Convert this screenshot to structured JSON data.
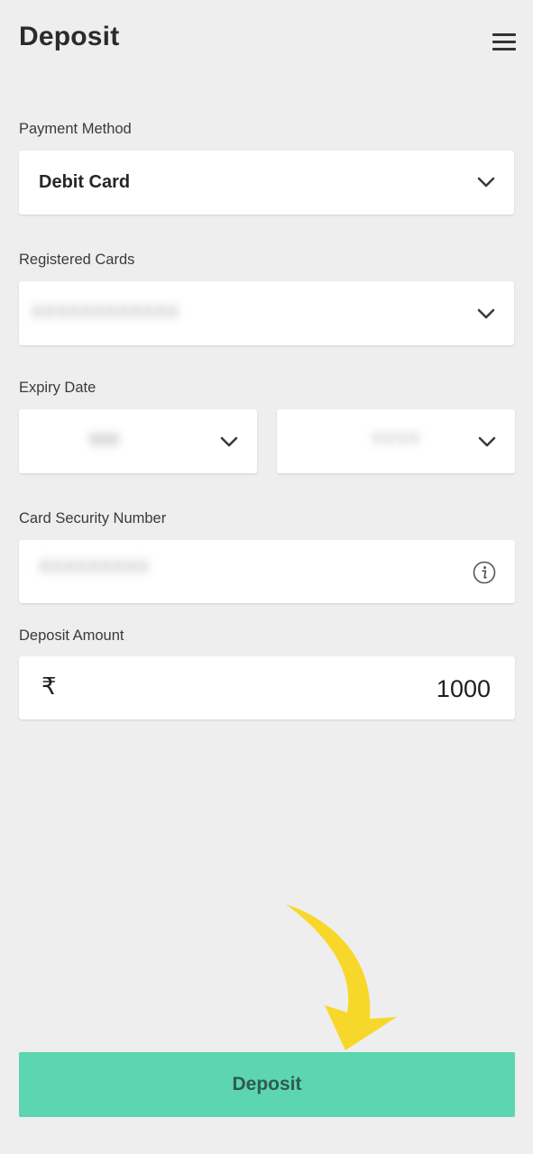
{
  "header": {
    "title": "Deposit",
    "menu_icon": "hamburger-menu-icon"
  },
  "form": {
    "payment_method": {
      "label": "Payment Method",
      "value": "Debit Card"
    },
    "registered_cards": {
      "label": "Registered Cards",
      "value": "XXXXXXXXXXXX"
    },
    "expiry_date": {
      "label": "Expiry Date",
      "month_value": "MM",
      "year_value": "YYYY"
    },
    "card_security_number": {
      "label": "Card Security Number",
      "value": "XXXXXXXXX",
      "info_icon": "info-icon"
    },
    "deposit_amount": {
      "label": "Deposit Amount",
      "currency_symbol": "₹",
      "value": "1000"
    }
  },
  "actions": {
    "deposit_label": "Deposit"
  },
  "colors": {
    "background": "#eeeeee",
    "button": "#5dd5b0",
    "button_text": "#2f5b4d",
    "arrow": "#f7d82a"
  }
}
